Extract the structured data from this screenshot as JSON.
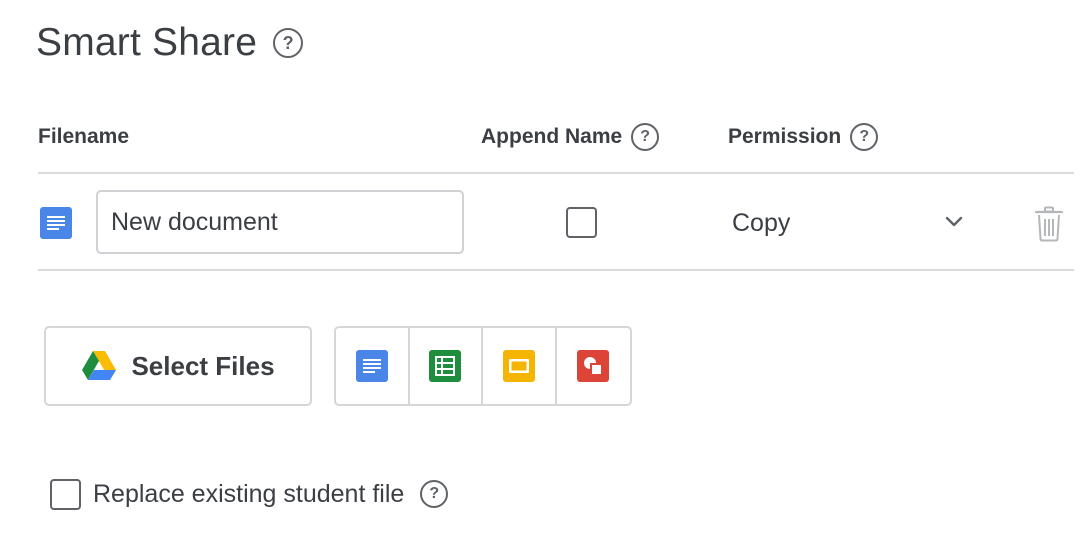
{
  "header": {
    "title": "Smart Share",
    "help_glyph": "?"
  },
  "table": {
    "columns": [
      {
        "label": "Filename",
        "help": false
      },
      {
        "label": "Append Name",
        "help": true
      },
      {
        "label": "Permission",
        "help": true
      }
    ],
    "help_glyph": "?",
    "rows": [
      {
        "file_type_icon": "google-docs-icon",
        "filename_value": "New document",
        "append_name_checked": false,
        "permission": "Copy",
        "permission_icon": "chevron-down-icon",
        "delete_icon": "trash-icon"
      }
    ]
  },
  "actions": {
    "select_files_label": "Select Files",
    "select_files_icon": "google-drive-icon",
    "new_file_types": [
      {
        "icon": "google-docs-icon",
        "color": "#4a86e8"
      },
      {
        "icon": "google-sheets-icon",
        "color": "#1e8e3e"
      },
      {
        "icon": "google-slides-icon",
        "color": "#f4b400"
      },
      {
        "icon": "google-drawings-icon",
        "color": "#db4437"
      }
    ]
  },
  "options": {
    "replace_label": "Replace existing student file",
    "replace_checked": false,
    "help_glyph": "?"
  }
}
